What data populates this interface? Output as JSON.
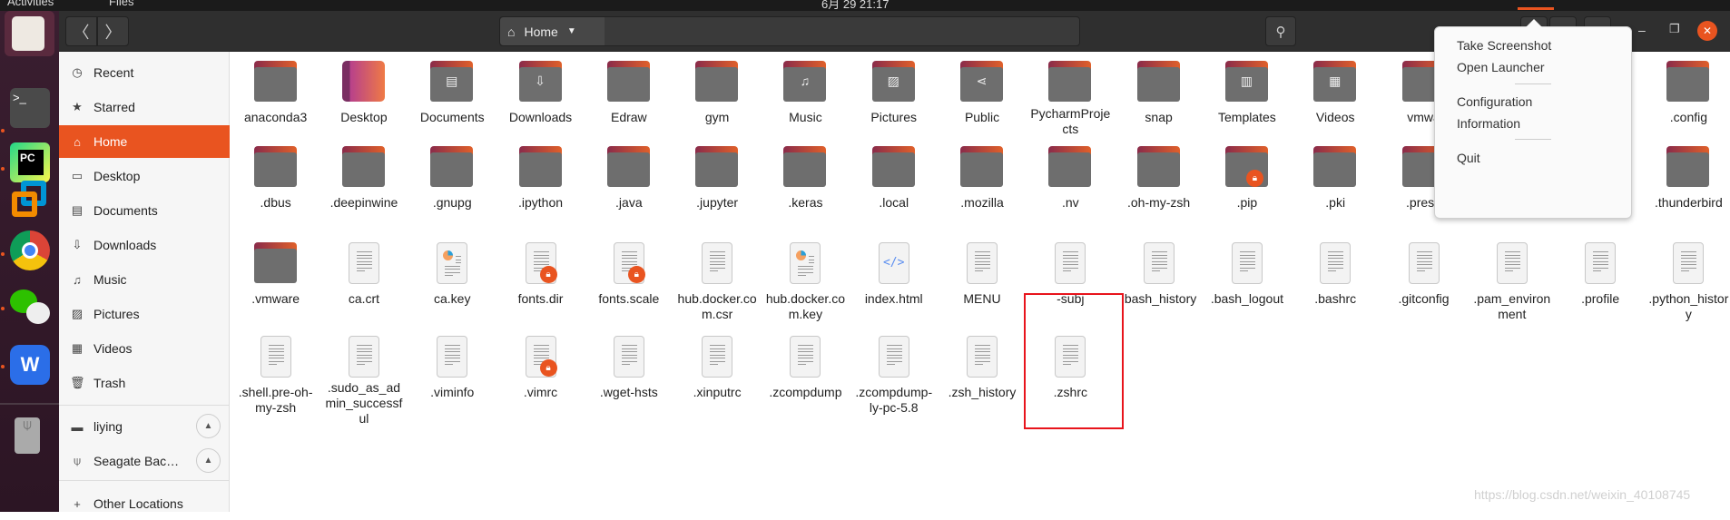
{
  "topbar": {
    "activities": "Activities",
    "app": "Files",
    "clock": "6月 29 21:17"
  },
  "header": {
    "back": "〈",
    "forward": "〉",
    "location": "Home",
    "search_icon": "search-icon",
    "minimize": "–",
    "maximize": "❐",
    "close": "✕"
  },
  "sidebar": {
    "items": [
      {
        "label": "Recent",
        "icon": "clock-icon"
      },
      {
        "label": "Starred",
        "icon": "star-icon"
      },
      {
        "label": "Home",
        "icon": "home-icon",
        "active": true
      },
      {
        "label": "Desktop",
        "icon": "desktop-icon"
      },
      {
        "label": "Documents",
        "icon": "document-icon"
      },
      {
        "label": "Downloads",
        "icon": "download-icon"
      },
      {
        "label": "Music",
        "icon": "music-icon"
      },
      {
        "label": "Pictures",
        "icon": "picture-icon"
      },
      {
        "label": "Videos",
        "icon": "video-icon"
      },
      {
        "label": "Trash",
        "icon": "trash-icon"
      }
    ],
    "devices": [
      {
        "label": "liying",
        "icon": "drive-icon"
      },
      {
        "label": "Seagate Bac…",
        "icon": "usb-icon"
      }
    ],
    "other": "Other Locations"
  },
  "files": [
    [
      {
        "n": "anaconda3",
        "t": "folder"
      },
      {
        "n": "Desktop",
        "t": "desktop"
      },
      {
        "n": "Documents",
        "t": "folder",
        "g": "▤"
      },
      {
        "n": "Downloads",
        "t": "folder",
        "g": "⇩"
      },
      {
        "n": "Edraw",
        "t": "folder"
      },
      {
        "n": "gym",
        "t": "folder"
      },
      {
        "n": "Music",
        "t": "folder",
        "g": "♫"
      },
      {
        "n": "Pictures",
        "t": "folder",
        "g": "▨"
      },
      {
        "n": "Public",
        "t": "folder",
        "g": "⋖"
      },
      {
        "n": "PycharmProjects",
        "t": "folder"
      },
      {
        "n": "snap",
        "t": "folder"
      },
      {
        "n": "Templates",
        "t": "folder",
        "g": "▥"
      },
      {
        "n": "Videos",
        "t": "folder",
        "g": "▦"
      },
      {
        "n": "vmwa",
        "t": "folder"
      },
      null,
      null,
      {
        "n": ".config",
        "t": "folder"
      }
    ],
    [
      {
        "n": ".dbus",
        "t": "folder"
      },
      {
        "n": ".deepinwine",
        "t": "folder"
      },
      {
        "n": ".gnupg",
        "t": "folder"
      },
      {
        "n": ".ipython",
        "t": "folder"
      },
      {
        "n": ".java",
        "t": "folder"
      },
      {
        "n": ".jupyter",
        "t": "folder"
      },
      {
        "n": ".keras",
        "t": "folder"
      },
      {
        "n": ".local",
        "t": "folder"
      },
      {
        "n": ".mozilla",
        "t": "folder"
      },
      {
        "n": ".nv",
        "t": "folder"
      },
      {
        "n": ".oh-my-zsh",
        "t": "folder"
      },
      {
        "n": ".pip",
        "t": "folder",
        "lock": true
      },
      {
        "n": ".pki",
        "t": "folder"
      },
      {
        "n": ".presa",
        "t": "folder"
      },
      null,
      null,
      {
        "n": ".thunderbird",
        "t": "folder"
      }
    ],
    [
      {
        "n": ".vmware",
        "t": "folder"
      },
      {
        "n": "ca.crt",
        "t": "text"
      },
      {
        "n": "ca.key",
        "t": "key"
      },
      {
        "n": "fonts.dir",
        "t": "text",
        "lock": true
      },
      {
        "n": "fonts.scale",
        "t": "text",
        "lock": true
      },
      {
        "n": "hub.docker.com.csr",
        "t": "text"
      },
      {
        "n": "hub.docker.com.key",
        "t": "key"
      },
      {
        "n": "index.html",
        "t": "html"
      },
      {
        "n": "MENU",
        "t": "text"
      },
      {
        "n": "-subj",
        "t": "text"
      },
      {
        "n": ".bash_history",
        "t": "text"
      },
      {
        "n": ".bash_logout",
        "t": "text"
      },
      {
        "n": ".bashrc",
        "t": "text"
      },
      {
        "n": ".gitconfig",
        "t": "text"
      },
      {
        "n": ".pam_environment",
        "t": "text"
      },
      {
        "n": ".profile",
        "t": "text"
      },
      {
        "n": ".python_history",
        "t": "text"
      }
    ],
    [
      {
        "n": ".shell.pre-oh-my-zsh",
        "t": "text"
      },
      {
        "n": ".sudo_as_admin_successful",
        "t": "text"
      },
      {
        "n": ".viminfo",
        "t": "text"
      },
      {
        "n": ".vimrc",
        "t": "text",
        "lock": true
      },
      {
        "n": ".wget-hsts",
        "t": "text"
      },
      {
        "n": ".xinputrc",
        "t": "text"
      },
      {
        "n": ".zcompdump",
        "t": "text"
      },
      {
        "n": ".zcompdump-ly-pc-5.8",
        "t": "text"
      },
      {
        "n": ".zsh_history",
        "t": "text"
      },
      {
        "n": ".zshrc",
        "t": "text",
        "highlighted": true
      }
    ]
  ],
  "menu": {
    "items": [
      "Take Screenshot",
      "Open Launcher",
      "Configuration",
      "Information",
      "Quit"
    ]
  },
  "watermark": "https://blog.csdn.net/weixin_40108745",
  "colors": {
    "accent": "#e95420",
    "highlight_box": "#e8141c"
  }
}
